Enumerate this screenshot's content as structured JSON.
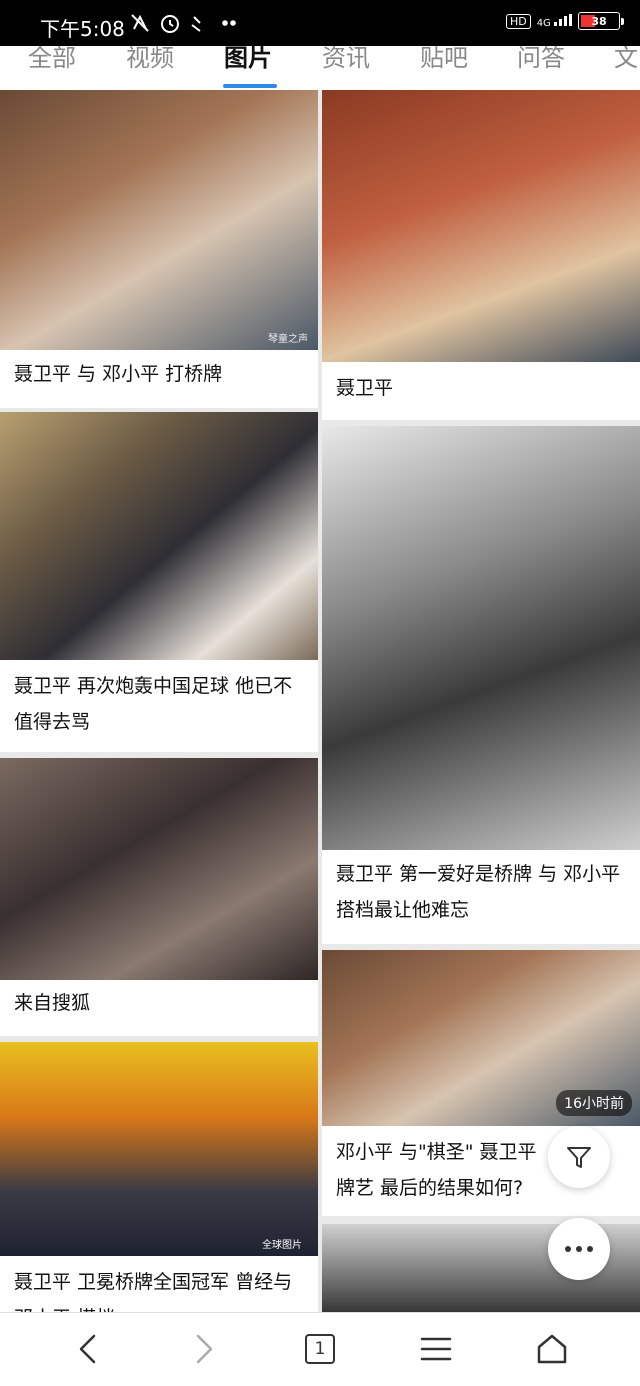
{
  "status_bar": {
    "time": "下午5:08",
    "hd": "HD",
    "network": "4G",
    "battery": "38"
  },
  "tabs": [
    {
      "label": "全部"
    },
    {
      "label": "视频"
    },
    {
      "label": "图片"
    },
    {
      "label": "资讯"
    },
    {
      "label": "贴吧"
    },
    {
      "label": "问答"
    },
    {
      "label": "文"
    }
  ],
  "active_tab": "图片",
  "cards": [
    {
      "caption": "聂卫平 与 邓小平 打桥牌",
      "watermark": "琴童之声"
    },
    {
      "caption": "聂卫平 再次炮轰中国足球 他已不值得去骂"
    },
    {
      "caption": "来自搜狐"
    },
    {
      "caption": "聂卫平 卫冕桥牌全国冠军 曾经与 邓小平 搭档",
      "watermark": "全球图片"
    },
    {
      "caption": "聂卫平"
    },
    {
      "caption": "聂卫平 第一爱好是桥牌 与 邓小平 搭档最让他难忘"
    },
    {
      "caption": "邓小平 与\"棋圣\" 聂卫平 牌艺 最后的结果如何?",
      "time_badge": "16小时前"
    }
  ],
  "nav": {
    "tab_count": "1"
  },
  "colors": {
    "accent": "#2e8ae6"
  }
}
